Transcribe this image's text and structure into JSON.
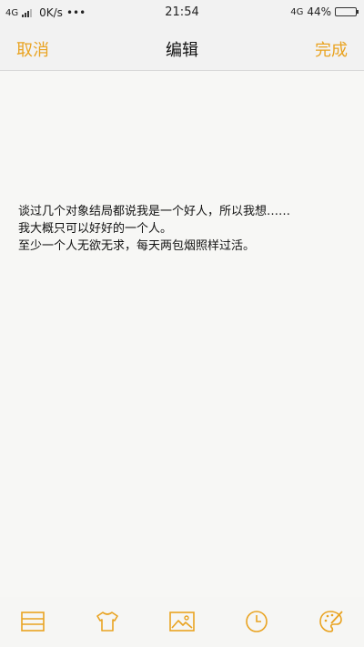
{
  "status_bar": {
    "network_left": "4G",
    "speed": "0K/s",
    "dots": "•••",
    "time": "21:54",
    "network_right": "4G",
    "battery_text": "44%",
    "battery_level": 0.44
  },
  "nav": {
    "cancel_label": "取消",
    "title": "编辑",
    "done_label": "完成"
  },
  "note": {
    "lines": [
      "谈过几个对象结局都说我是一个好人，所以我想……",
      "我大概只可以好好的一个人。",
      "至少一个人无欲无求，每天两包烟照样过活。"
    ]
  },
  "toolbar": {
    "items": [
      "list-icon",
      "shirt-icon",
      "image-icon",
      "clock-icon",
      "palette-icon"
    ],
    "accent_color": "#e9a321"
  }
}
